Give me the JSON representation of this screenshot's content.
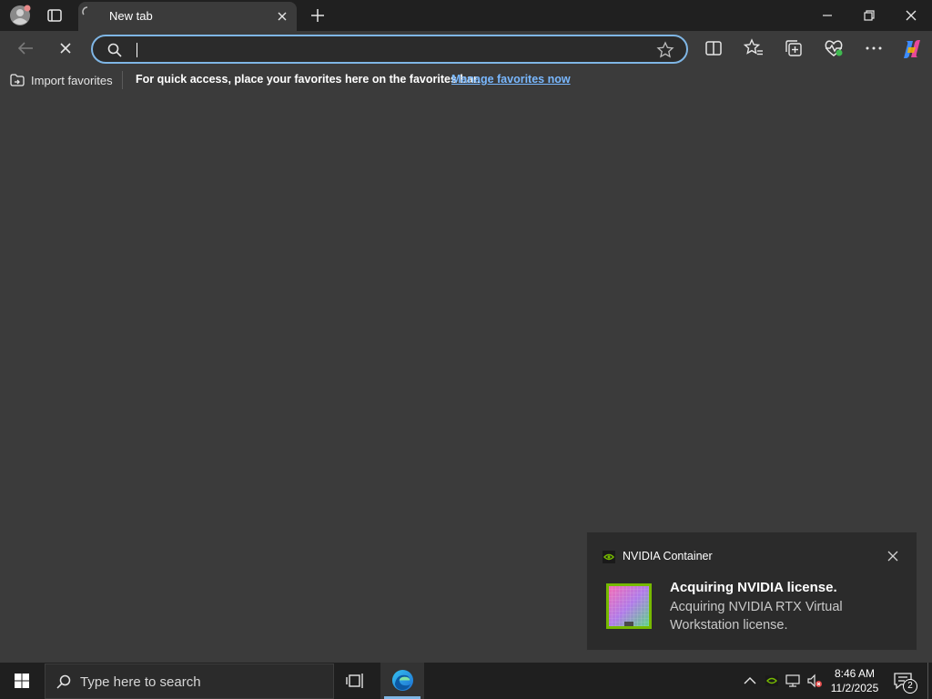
{
  "browser": {
    "tab": {
      "title": "New tab"
    },
    "address_bar": {
      "value": "",
      "placeholder": ""
    },
    "favorites_bar": {
      "import_label": "Import favorites",
      "message": "For quick access, place your favorites here on the favorites bar.",
      "link": "Manage favorites now"
    },
    "accent_color": "#7fb6e5"
  },
  "notification": {
    "app_name": "NVIDIA Container",
    "title": "Acquiring NVIDIA license.",
    "body": "Acquiring NVIDIA RTX Virtual Workstation license.",
    "brand_color": "#76b900"
  },
  "taskbar": {
    "search_placeholder": "Type here to search",
    "time": "8:46 AM",
    "date": "11/2/2025",
    "notification_count": "2"
  }
}
